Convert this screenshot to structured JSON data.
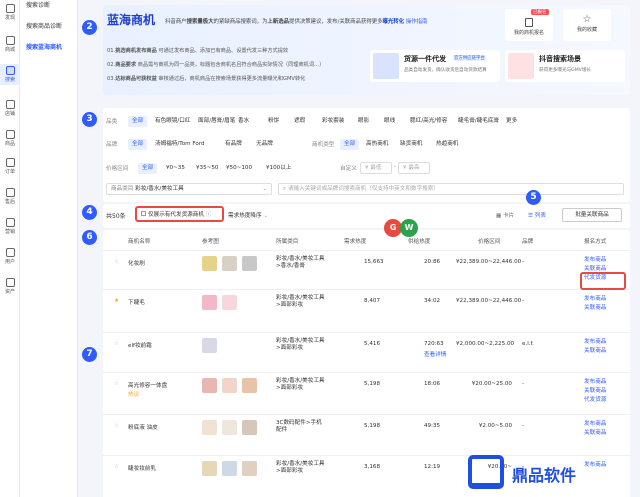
{
  "left_rail": {
    "items": [
      {
        "label": "发现",
        "icon": "home-icon"
      },
      {
        "label": "商城",
        "icon": "shop-icon"
      },
      {
        "label": "搜索",
        "icon": "search-icon",
        "active": true
      },
      {
        "label": "店铺",
        "icon": "store-icon"
      },
      {
        "label": "商品",
        "icon": "goods-icon"
      },
      {
        "label": "订单",
        "icon": "order-icon"
      },
      {
        "label": "售后",
        "icon": "aftersale-icon"
      },
      {
        "label": "营销",
        "icon": "marketing-icon"
      },
      {
        "label": "用户",
        "icon": "user-icon"
      },
      {
        "label": "资产",
        "icon": "asset-icon"
      }
    ]
  },
  "sub_nav": {
    "items": [
      {
        "label": "搜索诊断"
      },
      {
        "label": "搜索商品诊断"
      },
      {
        "label": "搜索蓝海商机",
        "active": true
      }
    ]
  },
  "banner": {
    "title": "蓝海商机",
    "subtitle_prefix": "抖音商户",
    "subtitle_bold1": "搜索量极大",
    "subtitle_mid": "的紧缺商品搜索词，为",
    "subtitle_bold2": "上新选品",
    "subtitle_rest": "提供决策建议，发布/关联商品获得更多",
    "subtitle_bold3": "曝光转化",
    "subtitle_link": "操作指南",
    "steps": [
      {
        "num": "01.",
        "bold": "挑选商机发布商品",
        "text": "可通过发布商品、添加已有商品、设置代发三种方式提效"
      },
      {
        "num": "02.",
        "bold": "商品要求",
        "text": "商品需与商机为同一品类，标题包含商机名且符合商品实际情况（同理商机词…）"
      },
      {
        "num": "03.",
        "bold": "达标商品可获权益",
        "text": "审核通过后，商机商品在搜索场景获得更多流量曝光和GMV转化"
      }
    ],
    "right_buttons": [
      {
        "label": "我的商机报名",
        "icon": "list-icon",
        "badge": "已报名"
      },
      {
        "label": "我的收藏",
        "icon": "star-icon"
      }
    ],
    "promo1": {
      "title": "货源一件代发",
      "badge": "官方供应链平台",
      "desc": "品类自动发货，确认收货后自动货款结算"
    },
    "promo2": {
      "title": "抖音搜索场景",
      "desc": "获得更多曝光与GMV增长"
    }
  },
  "markers": [
    "2",
    "3",
    "4",
    "5",
    "6",
    "7"
  ],
  "filters": {
    "category_label": "品类",
    "categories": [
      "全部",
      "有色眼镜/口红",
      "面部/唇膏/眉笔",
      "香水",
      "粉饼",
      "遮瑕",
      "彩妆套装",
      "眼影",
      "眼线",
      "腮红/高光/修容",
      "睫毛膏/睫毛底膏",
      "更多"
    ],
    "brand_label": "品牌",
    "brands": [
      "全部",
      "汤姆福特/Tom Ford",
      "有品牌",
      "无品牌"
    ],
    "channel_label": "商机类型",
    "channels": [
      "全部",
      "高热商机",
      "缺货商机",
      "热趋商机"
    ],
    "price_label": "价格区间",
    "prices": [
      "全部",
      "¥0~35",
      "¥35~50",
      "¥50~100",
      "¥100以上"
    ],
    "custom_price": {
      "label": "自定义",
      "low": "¥ 最低",
      "high": "¥ 最高"
    },
    "category_select": {
      "label": "商品类目",
      "value": "彩妆/香水/美妆工具"
    },
    "search_placeholder": "请输入关键词或品牌词搜索商机（仅支持中英文和数字搜索）"
  },
  "toolbar": {
    "count": "共50条",
    "only_supply": "仅展示有代发货源商机",
    "sort": "需求热度降序",
    "view_card": "卡片",
    "view_list": "列表",
    "batch": "批量关联商品"
  },
  "table": {
    "headers": [
      "商机名称",
      "参考图",
      "所属类目",
      "需求热度",
      "供给热度",
      "价格区间",
      "品牌",
      "报名方式"
    ],
    "rows": [
      {
        "name": "化妆刷",
        "category": "彩妆/香水/美妆工具>香水/香膏",
        "demand": "15,663",
        "supply": "20:86",
        "price": "¥22,389.00~22,446.00",
        "brand": "-",
        "actions": [
          "发布商品",
          "关联商品",
          "代发货源"
        ]
      },
      {
        "name": "下睫毛",
        "category": "彩妆/香水/美妆工具>面部彩妆",
        "demand": "8,407",
        "supply": "34:02",
        "price": "¥22,389.00~22,446.00",
        "brand": "-",
        "actions": [
          "发布商品",
          "关联商品"
        ]
      },
      {
        "name": "elf妆前霜",
        "category": "彩妆/香水/美妆工具>面部彩妆",
        "demand": "5,416",
        "supply": "720:63",
        "supply_note": "查看详情",
        "price": "¥2,000.00~2,225.00",
        "brand": "e.l.f.",
        "actions": [
          "发布商品",
          "关联商品"
        ]
      },
      {
        "name": "高光修容一体盘",
        "tag": "热议",
        "category": "彩妆/香水/美妆工具>面部彩妆",
        "demand": "5,198",
        "supply": "18:06",
        "price": "¥20.00~25.00",
        "brand": "-",
        "actions": [
          "发布商品",
          "关联商品",
          "代发货源"
        ]
      },
      {
        "name": "粉底液 油皮",
        "category": "3C数码配件>手机配件",
        "demand": "5,198",
        "supply": "49:35",
        "price": "¥2.00~5.00",
        "brand": "-",
        "actions": [
          "发布商品",
          "关联商品"
        ]
      },
      {
        "name": "睫妆妆前乳",
        "category": "彩妆/香水/美妆工具>面部彩妆",
        "demand": "3,168",
        "supply": "12:19",
        "price": "¥20.00~",
        "brand": "-",
        "actions": [
          "发布商品"
        ]
      }
    ]
  },
  "watermark": {
    "text": "鼎品软件"
  },
  "float_badges": [
    "G",
    "W"
  ]
}
